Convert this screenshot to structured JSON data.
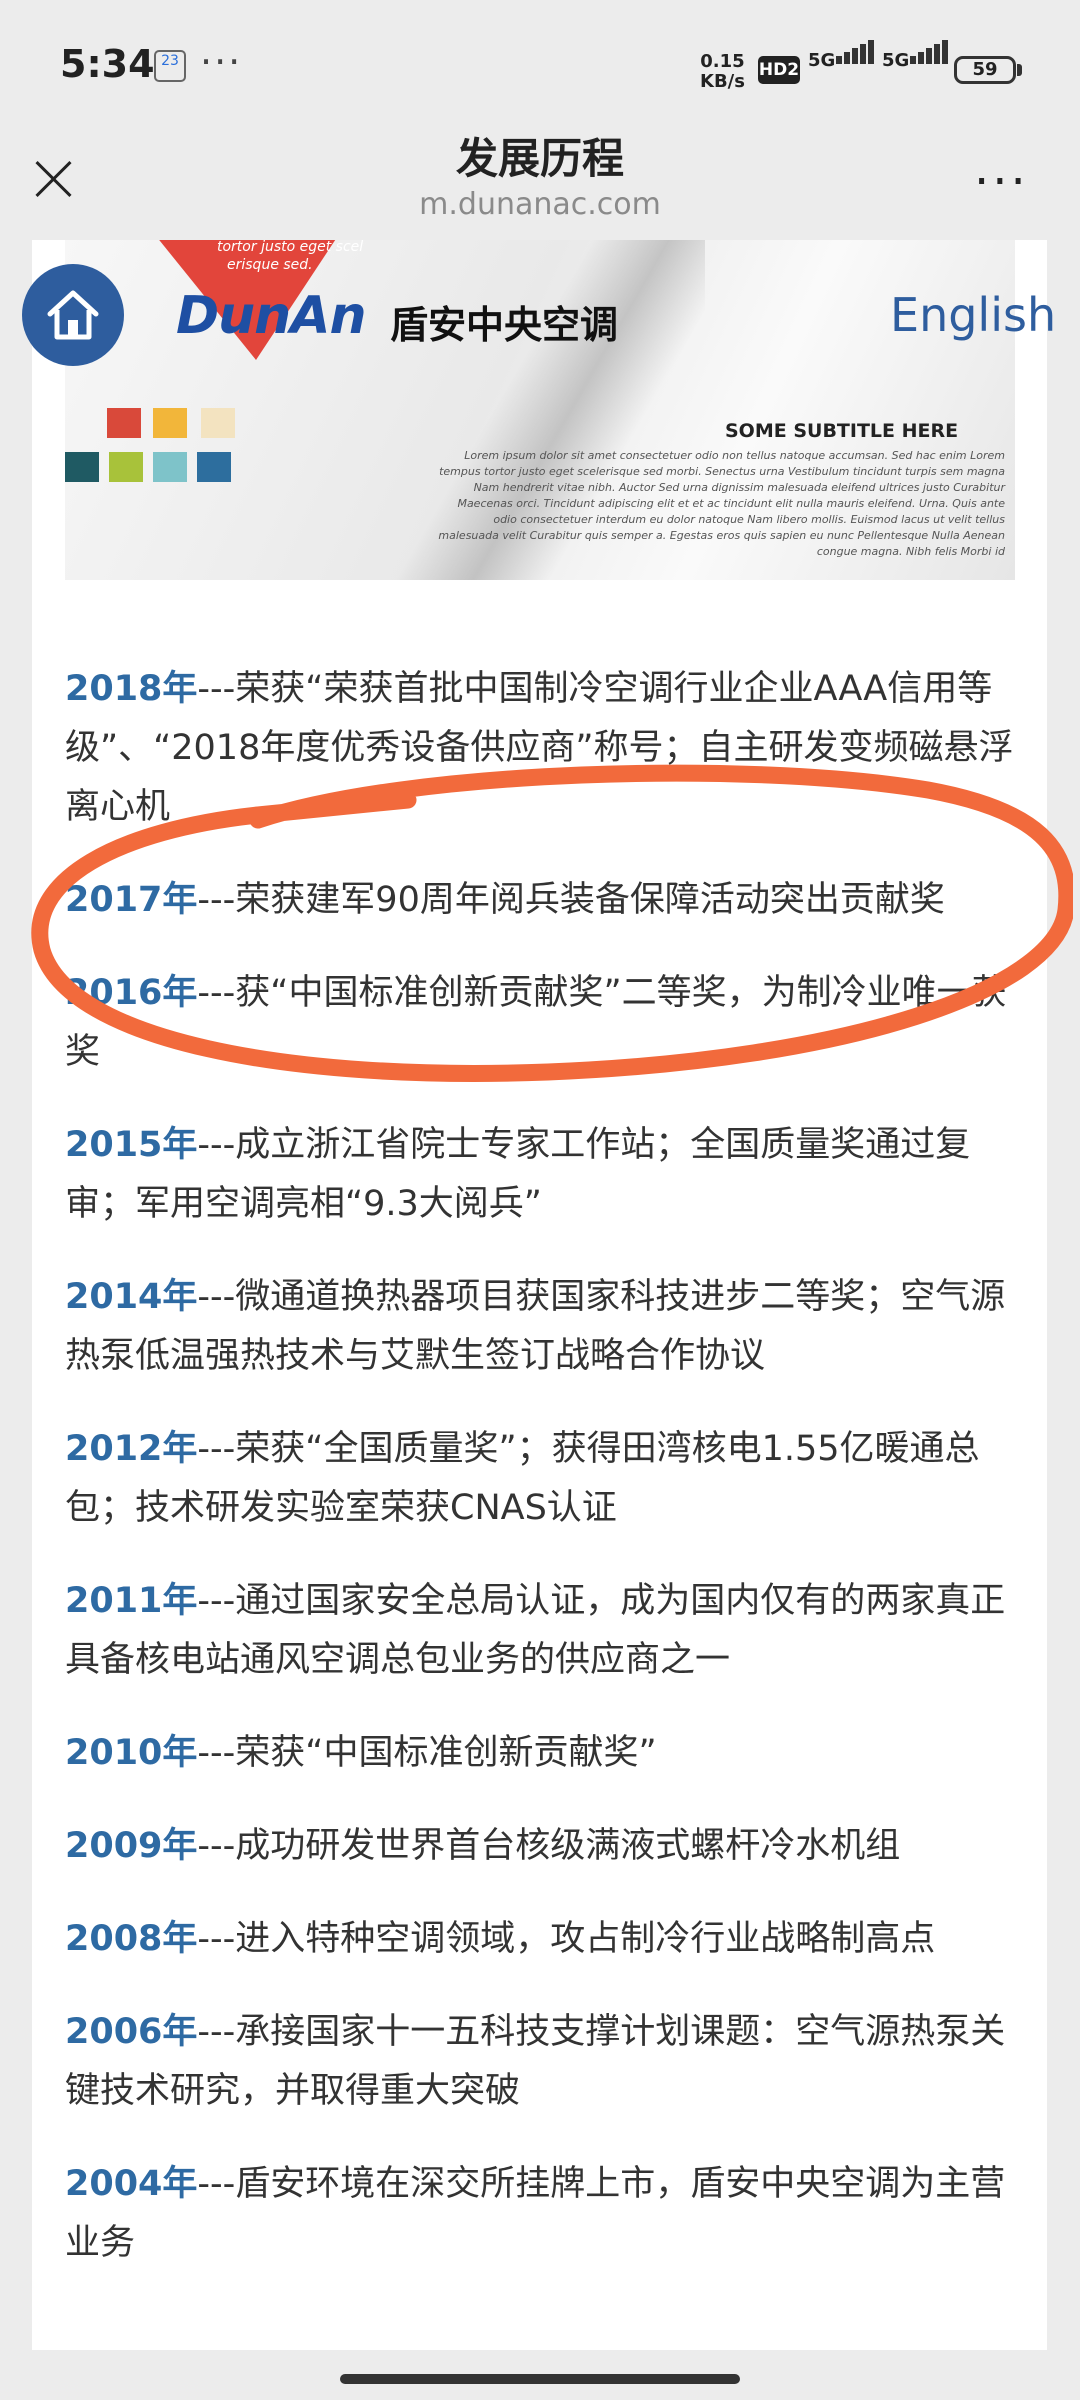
{
  "status_bar": {
    "time": "5:34",
    "calendar_day": "23",
    "more": "···",
    "net_speed_value": "0.15",
    "net_speed_unit": "KB/s",
    "hd_badge": "HD2",
    "signal1_label": "5G",
    "signal2_label": "5G",
    "battery": "59"
  },
  "title_bar": {
    "title": "发展历程",
    "url": "m.dunanac.com",
    "more": "···"
  },
  "banner": {
    "red_text_line1": "tortor justo eget scel",
    "red_text_line2": "erisque sed.",
    "subtitle": "SOME SUBTITLE HERE",
    "lorem": "Lorem ipsum dolor sit amet consectetuer odio non tellus natoque accumsan. Sed hac enim Lorem tempus tortor justo eget scelerisque sed morbi. Senectus urna Vestibulum tincidunt turpis sem magna Nam hendrerit vitae nibh. Auctor Sed urna dignissim malesuada eleifend ultrices justo Curabitur Maecenas orci. Tincidunt adipiscing elit et et ac tincidunt elit nulla mauris eleifend. Urna. Quis ante odio consectetuer interdum eu dolor natoque Nam libero mollis. Euismod lacus ut velit tellus malesuada velit Curabitur quis semper a. Egestas eros quis sapien eu nunc Pellentesque Nulla Aenean congue magna. Nibh felis Morbi id"
  },
  "header": {
    "logo_en": "DunAn",
    "logo_cn": "盾安中央空调",
    "english_link": "English"
  },
  "timeline": [
    {
      "year": "2018年",
      "text": "---荣获“荣获首批中国制冷空调行业企业AAA信用等级”、“2018年度优秀设备供应商”称号；自主研发变频磁悬浮离心机"
    },
    {
      "year": "2017年",
      "text": "---荣获建军90周年阅兵装备保障活动突出贡献奖"
    },
    {
      "year": "2016年",
      "text": "---获“中国标准创新贡献奖”二等奖，为制冷业唯一获奖"
    },
    {
      "year": "2015年",
      "text": "---成立浙江省院士专家工作站；全国质量奖通过复审；军用空调亮相“9.3大阅兵”"
    },
    {
      "year": "2014年",
      "text": "---微通道换热器项目获国家科技进步二等奖；空气源热泵低温强热技术与艾默生签订战略合作协议"
    },
    {
      "year": "2012年",
      "text": "---荣获“全国质量奖”；获得田湾核电1.55亿暖通总包；技术研发实验室荣获CNAS认证"
    },
    {
      "year": "2011年",
      "text": "---通过国家安全总局认证，成为国内仅有的两家真正具备核电站通风空调总包业务的供应商之一"
    },
    {
      "year": "2010年",
      "text": "---荣获“中国标准创新贡献奖”"
    },
    {
      "year": "2009年",
      "text": "---成功研发世界首台核级满液式螺杆冷水机组"
    },
    {
      "year": "2008年",
      "text": "---进入特种空调领域，攻占制冷行业战略制高点"
    },
    {
      "year": "2006年",
      "text": "---承接国家十一五科技支撑计划课题：空气源热泵关键技术研究，并取得重大突破"
    },
    {
      "year": "2004年",
      "text": "---盾安环境在深交所挂牌上市，盾安中央空调为主营业务"
    }
  ],
  "colors": {
    "year": "#2e6aa3",
    "accent": "#2e5d9e",
    "highlight": "#f26a3c"
  }
}
